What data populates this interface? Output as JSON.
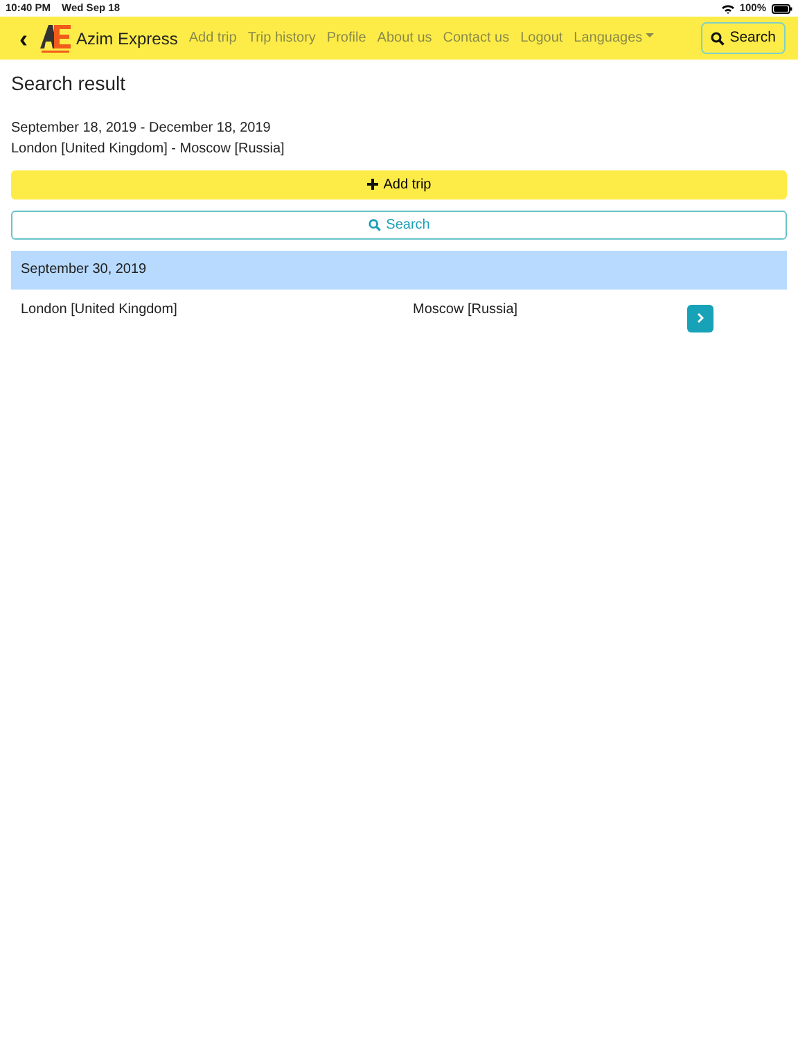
{
  "status_bar": {
    "time": "10:40 PM",
    "date": "Wed Sep 18",
    "battery": "100%"
  },
  "navbar": {
    "back": "‹",
    "brand": "Azim Express",
    "links": [
      {
        "label": "Add trip"
      },
      {
        "label": "Trip history"
      },
      {
        "label": "Profile"
      },
      {
        "label": "About us"
      },
      {
        "label": "Contact us"
      },
      {
        "label": "Logout"
      },
      {
        "label": "Languages",
        "kind": "dropdown"
      }
    ],
    "search_button": "Search"
  },
  "title": "Search result",
  "date_range": "September 18, 2019 - December 18, 2019",
  "route": "London [United Kingdom] - Moscow [Russia]",
  "add_trip_button": "Add trip",
  "search_button": "Search",
  "groups": [
    {
      "date": "September 30, 2019",
      "trips": [
        {
          "from": "London [United Kingdom]",
          "to": "Moscow [Russia]"
        }
      ]
    }
  ]
}
